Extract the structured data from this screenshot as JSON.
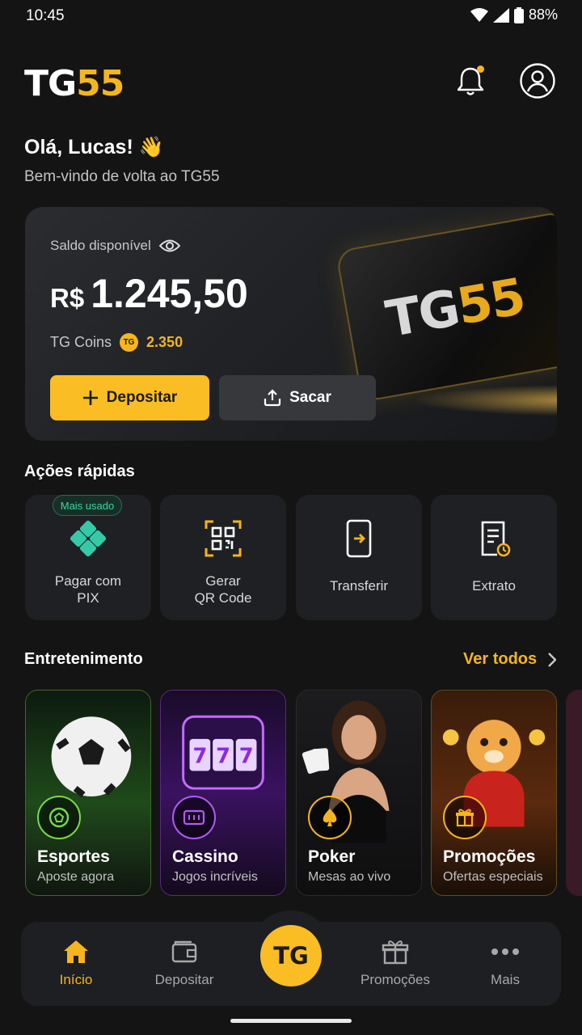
{
  "status": {
    "time": "10:45",
    "battery": "88%"
  },
  "header": {
    "logo_white": "TG",
    "logo_yellow": "55"
  },
  "greeting": {
    "hello": "Olá, Lucas! 👋",
    "welcome": "Bem-vindo de volta ao TG55"
  },
  "balance": {
    "label": "Saldo disponível",
    "currency": "R$",
    "amount": "1.245,50",
    "coins_label": "TG Coins",
    "coins_badge": "TG",
    "coins_value": "2.350",
    "deposit_label": "Depositar",
    "withdraw_label": "Sacar",
    "card_logo_white": "TG",
    "card_logo_yellow": "55"
  },
  "quick_actions": {
    "title": "Ações rápidas",
    "items": [
      {
        "label_1": "Pagar com",
        "label_2": "PIX",
        "tag": "Mais usado",
        "icon": "pix-icon"
      },
      {
        "label_1": "Gerar",
        "label_2": "QR Code",
        "icon": "qr-code-icon"
      },
      {
        "label_1": "Transferir",
        "icon": "transfer-icon"
      },
      {
        "label_1": "Extrato",
        "icon": "statement-icon"
      }
    ]
  },
  "entertainment": {
    "title": "Entretenimento",
    "see_all": "Ver todos",
    "items": [
      {
        "title": "Esportes",
        "subtitle": "Aposte agora",
        "icon": "soccer-icon",
        "accent": "#7bd94a"
      },
      {
        "title": "Cassino",
        "subtitle": "Jogos incríveis",
        "icon": "slot-icon",
        "accent": "#b05cf0"
      },
      {
        "title": "Poker",
        "subtitle": "Mesas ao vivo",
        "icon": "spade-icon",
        "accent": "#f5b51e"
      },
      {
        "title": "Promoções",
        "subtitle": "Ofertas especiais",
        "icon": "gift-icon",
        "accent": "#f5b51e"
      }
    ]
  },
  "nav": {
    "home": "Início",
    "deposit": "Depositar",
    "center": "TG",
    "promos": "Promoções",
    "more": "Mais"
  },
  "colors": {
    "accent": "#f5b51e",
    "background": "#141414",
    "card": "#1f2023"
  }
}
